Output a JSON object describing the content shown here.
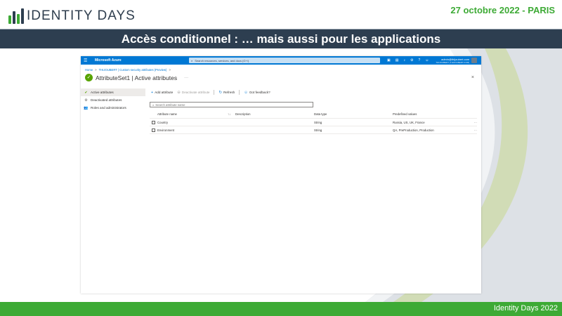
{
  "slide": {
    "logo_text": "IDENTITY DAYS",
    "event_date": "27 octobre 2022  - PARIS",
    "title": "Accès conditionnel : … mais aussi pour les applications",
    "footer": "Identity Days 2022",
    "colors": {
      "navy": "#2d3e50",
      "green": "#3daa35",
      "azure_blue": "#0078d4"
    }
  },
  "azure": {
    "brand": "Microsoft Azure",
    "search_placeholder": "Search resources, services, and docs (G+/)",
    "account_email": "admin@thijoubert.com",
    "account_tenant": "THIJOUBERT (THIJOUBERT.COM)",
    "topbar_icons": [
      "cloud-shell-icon",
      "directory-filter-icon",
      "notifications-icon",
      "settings-icon",
      "help-icon",
      "feedback-icon"
    ]
  },
  "breadcrumb": {
    "home": "Home",
    "sep": ">",
    "parent": "THIJOUBERT | Custom security attributes (Preview)"
  },
  "blade": {
    "title": "AttributeSet1 | Active attributes",
    "more": "···",
    "close": "×"
  },
  "nav": {
    "collapse": "«",
    "items": [
      {
        "label": "Active attributes",
        "icon": "check-circle-icon"
      },
      {
        "label": "Deactivated attributes",
        "icon": "gear-icon"
      },
      {
        "label": "Roles and administrators",
        "icon": "people-icon"
      }
    ]
  },
  "toolbar": {
    "add": "Add attribute",
    "deactivate": "Deactivate attribute",
    "refresh": "Refresh",
    "feedback": "Got feedback?"
  },
  "search": {
    "placeholder": "Search attribute name"
  },
  "table": {
    "columns": [
      "Attribute name",
      "Description",
      "Data type",
      "Predefined values"
    ],
    "sort_icon": "↑↓",
    "rows": [
      {
        "name": "Country",
        "description": "",
        "type": "String",
        "values": "Russia, US, UK, France",
        "more": "···"
      },
      {
        "name": "Environment",
        "description": "",
        "type": "String",
        "values": "QA, PreProduction, Production",
        "more": "···"
      }
    ]
  }
}
